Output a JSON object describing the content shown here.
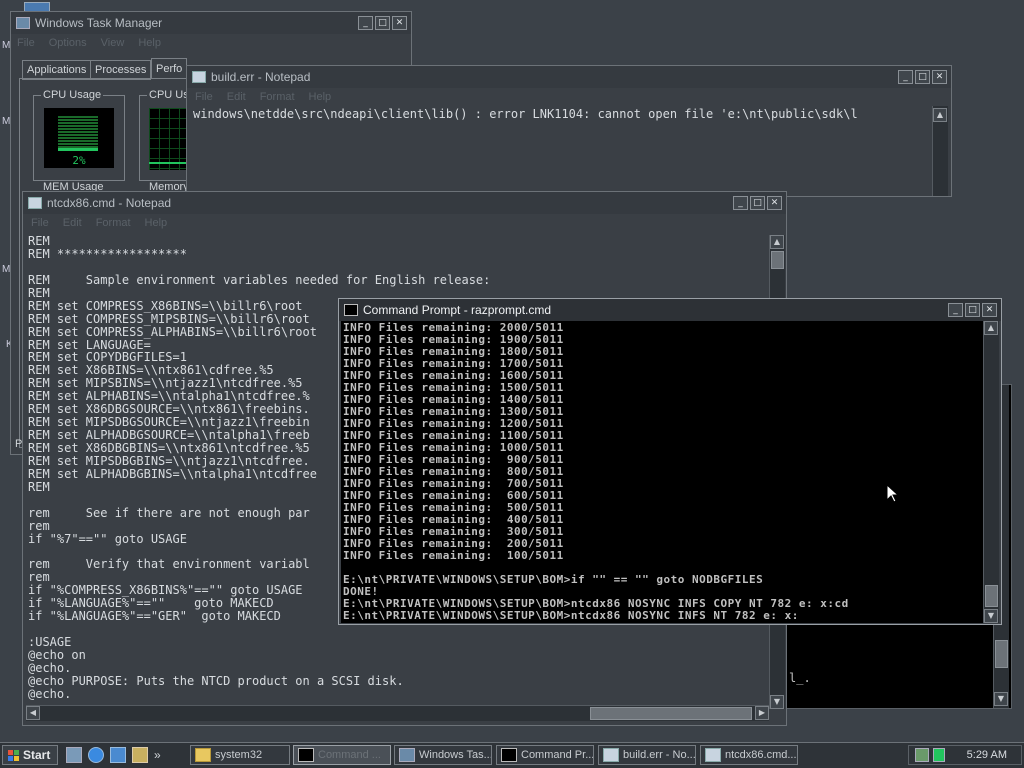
{
  "taskmgr": {
    "title": "Windows Task Manager",
    "menu": [
      "File",
      "Options",
      "View",
      "Help"
    ],
    "tabs": [
      "Applications",
      "Processes",
      "Perfo"
    ],
    "cpu_usage_label": "CPU Usage",
    "cpu_value": "2%",
    "cpu_history_label": "CPU Us",
    "mem_usage_label": "MEM Usage",
    "memory_label": "Memory",
    "status_fragment": "P"
  },
  "builderr": {
    "title": "build.err - Notepad",
    "menu": [
      "File",
      "Edit",
      "Format",
      "Help"
    ],
    "line": "windows\\netdde\\src\\ndeapi\\client\\lib() : error LNK1104: cannot open file 'e:\\nt\\public\\sdk\\l"
  },
  "ntcd": {
    "title": "ntcdx86.cmd - Notepad",
    "menu": [
      "File",
      "Edit",
      "Format",
      "Help"
    ],
    "lines": [
      "REM",
      "REM ******************",
      "",
      "REM     Sample environment variables needed for English release:",
      "REM",
      "REM set COMPRESS_X86BINS=\\\\billr6\\root",
      "REM set COMPRESS_MIPSBINS=\\\\billr6\\root",
      "REM set COMPRESS_ALPHABINS=\\\\billr6\\root",
      "REM set LANGUAGE=",
      "REM set COPYDBGFILES=1",
      "REM set X86BINS=\\\\ntx861\\cdfree.%5",
      "REM set MIPSBINS=\\\\ntjazz1\\ntcdfree.%5",
      "REM set ALPHABINS=\\\\ntalpha1\\ntcdfree.%",
      "REM set X86DBGSOURCE=\\\\ntx861\\freebins.",
      "REM set MIPSDBGSOURCE=\\\\ntjazz1\\freebin",
      "REM set ALPHADBGSOURCE=\\\\ntalpha1\\freeb",
      "REM set X86DBGBINS=\\\\ntx861\\ntcdfree.%5",
      "REM set MIPSDBGBINS=\\\\ntjazz1\\ntcdfree.",
      "REM set ALPHADBGBINS=\\\\ntalpha1\\ntcdfree",
      "REM",
      "",
      "rem     See if there are not enough par",
      "rem",
      "if \"%7\"==\"\" goto USAGE",
      "",
      "rem     Verify that environment variabl",
      "rem",
      "if \"%COMPRESS_X86BINS%\"==\"\" goto USAGE",
      "if \"%LANGUAGE%\"==\"\"    goto MAKECD",
      "if \"%LANGUAGE%\"==\"GER\"  goto MAKECD",
      "",
      ":USAGE",
      "@echo on",
      "@echo.",
      "@echo PURPOSE: Puts the NTCD product on a SCSI disk.",
      "@echo."
    ]
  },
  "cmd": {
    "title": "Command Prompt - razprompt.cmd",
    "lines": [
      "INFO Files remaining: 2000/5011",
      "INFO Files remaining: 1900/5011",
      "INFO Files remaining: 1800/5011",
      "INFO Files remaining: 1700/5011",
      "INFO Files remaining: 1600/5011",
      "INFO Files remaining: 1500/5011",
      "INFO Files remaining: 1400/5011",
      "INFO Files remaining: 1300/5011",
      "INFO Files remaining: 1200/5011",
      "INFO Files remaining: 1100/5011",
      "INFO Files remaining: 1000/5011",
      "INFO Files remaining:  900/5011",
      "INFO Files remaining:  800/5011",
      "INFO Files remaining:  700/5011",
      "INFO Files remaining:  600/5011",
      "INFO Files remaining:  500/5011",
      "INFO Files remaining:  400/5011",
      "INFO Files remaining:  300/5011",
      "INFO Files remaining:  200/5011",
      "INFO Files remaining:  100/5011",
      "",
      "E:\\nt\\PRIVATE\\WINDOWS\\SETUP\\BOM>if \"\" == \"\" goto NODBGFILES",
      "DONE!",
      "E:\\nt\\PRIVATE\\WINDOWS\\SETUP\\BOM>ntcdx86 NOSYNC INFS COPY NT 782 e: x:cd",
      "E:\\nt\\PRIVATE\\WINDOWS\\SETUP\\BOM>ntcdx86 NOSYNC INFS NT 782 e: x:"
    ]
  },
  "bg_console": {
    "fragment": "l_."
  },
  "desktop": {
    "edge_letters": [
      "M",
      "M",
      "M",
      "K"
    ]
  },
  "taskbar": {
    "start_label": "Start",
    "chevron": "»",
    "tasks": [
      "system32",
      "Command ...",
      "Windows Tas...",
      "Command Pr...",
      "build.err - No...",
      "ntcdx86.cmd..."
    ],
    "clock": "5:29 AM"
  },
  "colors": {
    "cmd_title_bg": "#2d3136",
    "console_bg": "#000000",
    "console_text": "#c0c0c0",
    "graph_green": "#22c55e"
  }
}
